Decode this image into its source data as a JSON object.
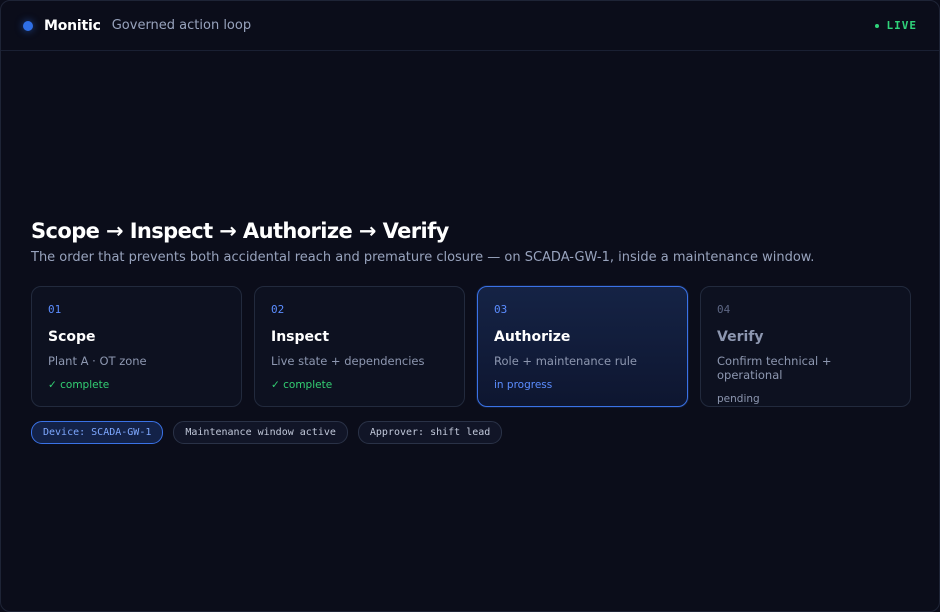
{
  "header": {
    "brand": "Monitic",
    "subtitle": "Governed action loop",
    "live": "LIVE",
    "accent": "#2f6fe6",
    "live_color": "#2fd37a"
  },
  "main": {
    "title": "Scope → Inspect → Authorize → Verify",
    "subtitle": "The order that prevents both accidental reach and premature closure — on SCADA-GW-1, inside a maintenance window.",
    "steps": [
      {
        "num": "01",
        "title": "Scope",
        "desc": "Plant A · OT zone",
        "status": "✓ complete",
        "state": "complete"
      },
      {
        "num": "02",
        "title": "Inspect",
        "desc": "Live state + dependencies",
        "status": "✓ complete",
        "state": "complete"
      },
      {
        "num": "03",
        "title": "Authorize",
        "desc": "Role + maintenance rule",
        "status": "in progress",
        "state": "in-progress"
      },
      {
        "num": "04",
        "title": "Verify",
        "desc": "Confirm technical + operational",
        "status": "pending",
        "state": "pending"
      }
    ],
    "tags": [
      {
        "label": "Device: SCADA-GW-1"
      },
      {
        "label": "Maintenance window active"
      },
      {
        "label": "Approver: shift lead"
      }
    ]
  }
}
